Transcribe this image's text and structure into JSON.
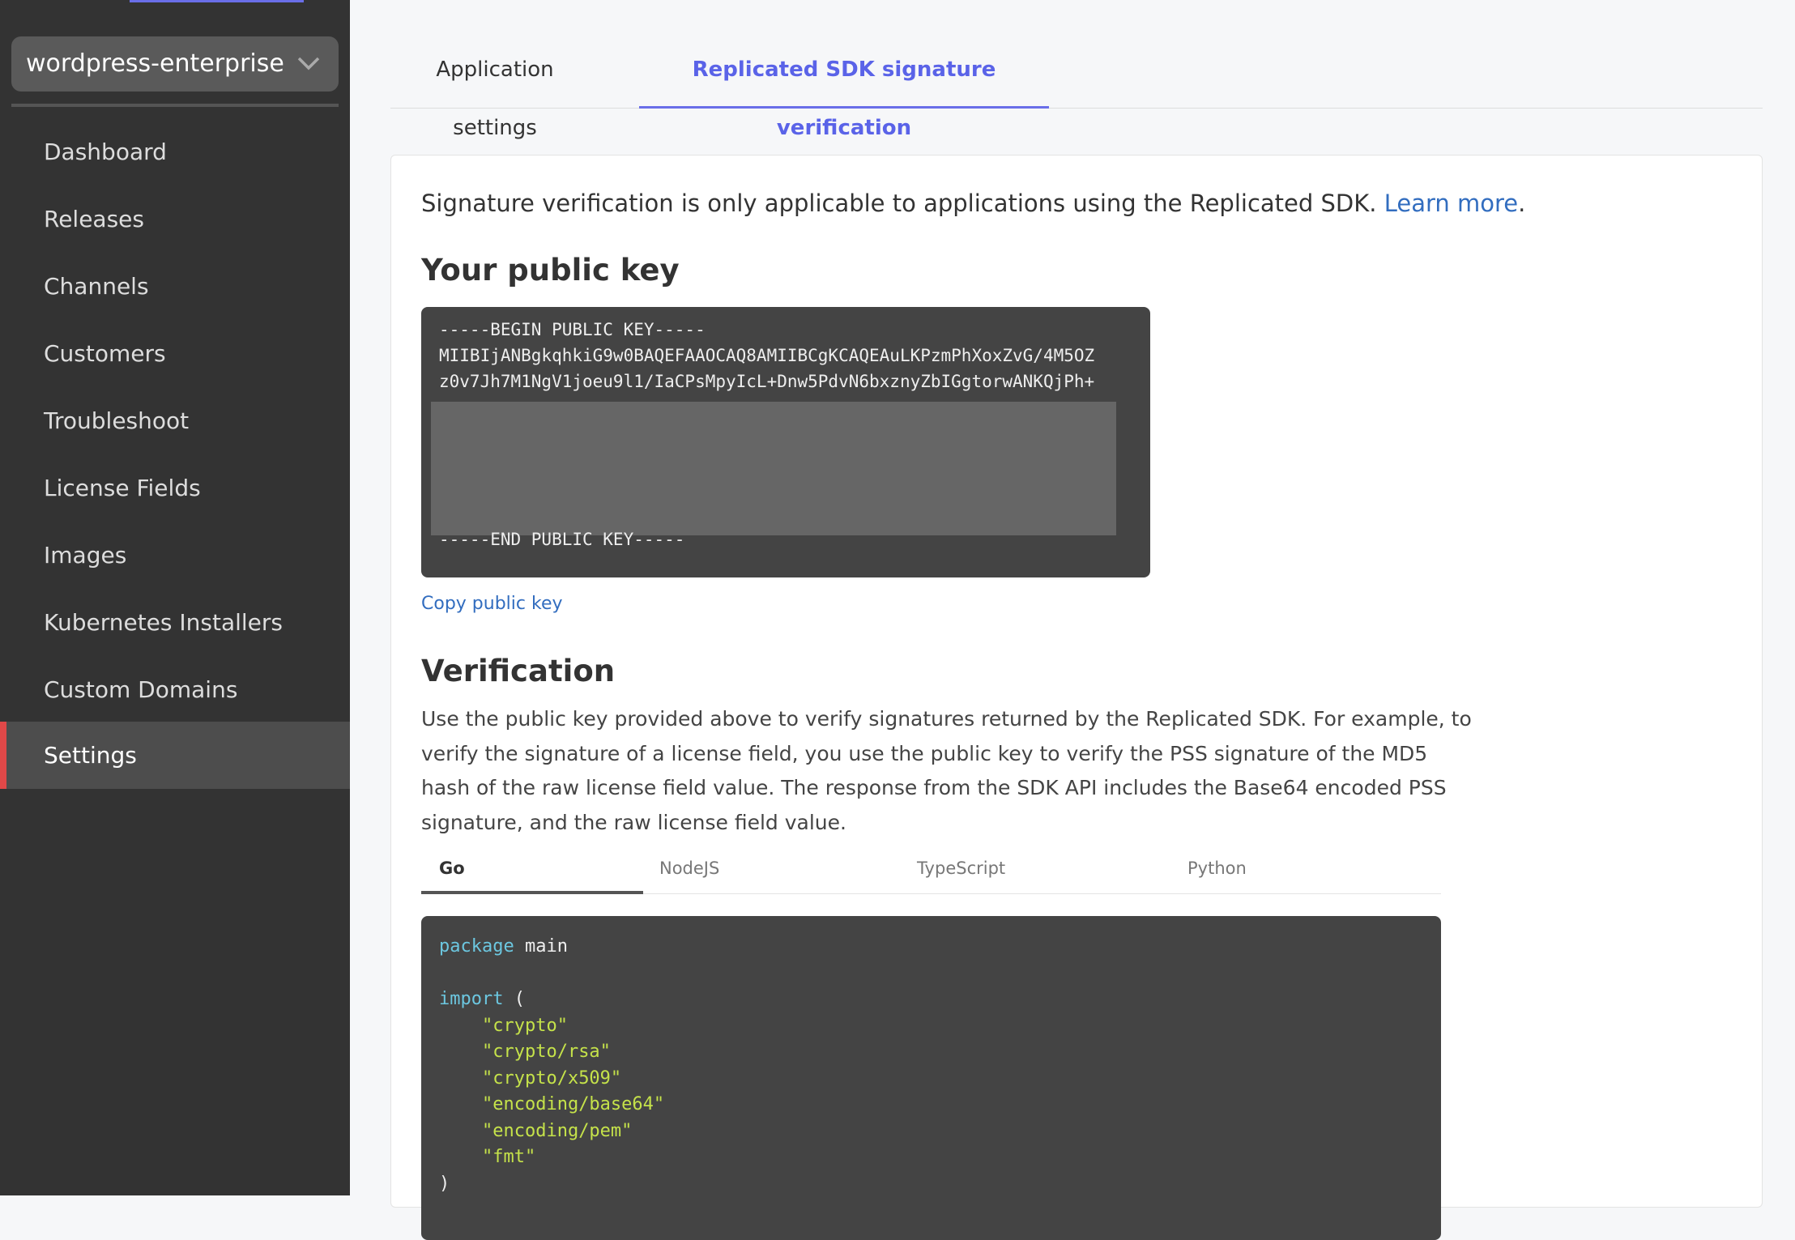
{
  "sidebar": {
    "app_name": "wordpress-enterprise",
    "items": [
      {
        "label": "Dashboard"
      },
      {
        "label": "Releases"
      },
      {
        "label": "Channels"
      },
      {
        "label": "Customers"
      },
      {
        "label": "Troubleshoot"
      },
      {
        "label": "License Fields"
      },
      {
        "label": "Images"
      },
      {
        "label": "Kubernetes Installers"
      },
      {
        "label": "Custom Domains"
      },
      {
        "label": "Settings",
        "active": true
      }
    ]
  },
  "tabs": [
    {
      "label": "Application settings"
    },
    {
      "label": "Replicated SDK signature verification",
      "active": true
    }
  ],
  "content": {
    "intro": "Signature verification is only applicable to applications using the Replicated SDK. ",
    "learn_more": "Learn more",
    "intro_end": ".",
    "public_key_heading": "Your public key",
    "key_lines": [
      "-----BEGIN PUBLIC KEY-----",
      "MIIBIjANBgkqhkiG9w0BAQEFAAOCAQ8AMIIBCgKCAQEAuLKPzmPhXoxZvG/4M5OZ",
      "z0v7Jh7M1NgV1joeu9l1/IaCPsMpyIcL+Dnw5PdvN6bxznyZbIGgtorwANKQjPh+"
    ],
    "key_end": "-----END PUBLIC KEY-----",
    "copy_label": "Copy public key",
    "verification_heading": "Verification",
    "verification_text": "Use the public key provided above to verify signatures returned by the Replicated SDK. For example, to verify the signature of a license field, you use the public key to verify the PSS signature of the MD5 hash of the raw license field value. The response from the SDK API includes the Base64 encoded PSS signature, and the raw license field value.",
    "code_tabs": [
      {
        "label": "Go",
        "active": true
      },
      {
        "label": "NodeJS"
      },
      {
        "label": "TypeScript"
      },
      {
        "label": "Python"
      }
    ],
    "code": {
      "package_kw": "package",
      "package_name": " main",
      "import_kw": "import",
      "import_open": " (",
      "imports": [
        "\"crypto\"",
        "\"crypto/rsa\"",
        "\"crypto/x509\"",
        "\"encoding/base64\"",
        "\"encoding/pem\"",
        "\"fmt\""
      ],
      "import_close": ")"
    }
  },
  "colors": {
    "accent": "#6a6ee8",
    "active_marker": "#e04848",
    "link": "#326dbf",
    "code_keyword": "#6cc7e0",
    "code_string": "#c5e24a"
  }
}
